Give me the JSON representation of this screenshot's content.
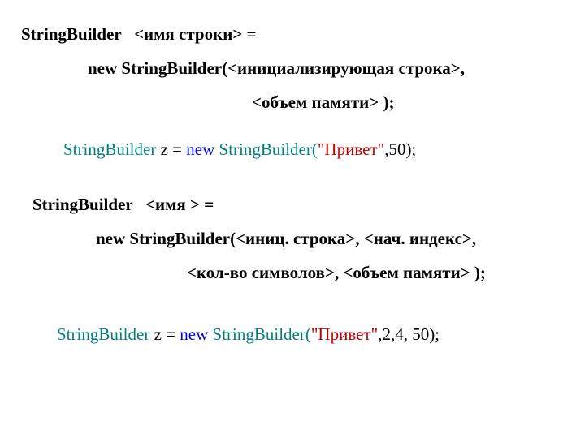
{
  "block1": {
    "l1a": "StringBuilder",
    "l1b": "   <имя строки> = ",
    "l2a": "new StringBuilder(",
    "l2b": "<инициализирующая строка>, ",
    "l3a": "<объем памяти> ",
    "l3b": ");"
  },
  "example1": {
    "p1": "StringBuilder ",
    "p2": "z = ",
    "p3": "new ",
    "p4": "StringBuilder(",
    "p5": "\"Привет\"",
    "p6": ",50);"
  },
  "block2": {
    "l1a": "StringBuilder",
    "l1b": "   <имя > = ",
    "l2a": "new StringBuilder(",
    "l2b": "<иниц. строка>, <нач. индекс>, ",
    "l3a": "<кол-во символов>, <объем памяти> ",
    "l3b": ");"
  },
  "example2": {
    "p1": "StringBuilder ",
    "p2": "z = ",
    "p3": "new ",
    "p4": "StringBuilder(",
    "p5": "\"Привет\"",
    "p6": ",2,4, 50);"
  }
}
